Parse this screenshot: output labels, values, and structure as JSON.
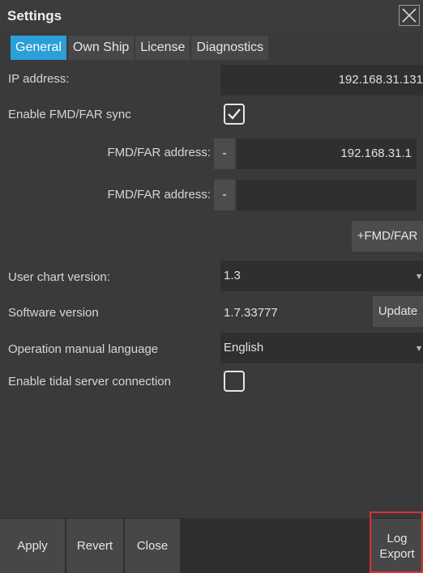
{
  "window": {
    "title": "Settings"
  },
  "tabs": [
    {
      "label": "General",
      "active": true
    },
    {
      "label": "Own Ship",
      "active": false
    },
    {
      "label": "License",
      "active": false
    },
    {
      "label": "Diagnostics",
      "active": false
    }
  ],
  "general": {
    "ip_address": {
      "label": "IP address:",
      "value": "192.168.31.131"
    },
    "fmd_sync": {
      "label": "Enable FMD/FAR sync",
      "checked": true
    },
    "fmd_address_1": {
      "label": "FMD/FAR address:",
      "minus": "-",
      "value": "192.168.31.1"
    },
    "fmd_address_2": {
      "label": "FMD/FAR address:",
      "minus": "-",
      "value": ""
    },
    "add_fmd_button": "+FMD/FAR",
    "user_chart_version": {
      "label": "User chart version:",
      "value": "1.3"
    },
    "software_version": {
      "label": "Software version",
      "value": "1.7.33777",
      "update_button": "Update"
    },
    "manual_language": {
      "label": "Operation manual language",
      "value": "English"
    },
    "tidal_server": {
      "label": "Enable tidal server connection",
      "checked": false
    }
  },
  "footer": {
    "apply": "Apply",
    "revert": "Revert",
    "close": "Close",
    "log_export_line1": "Log",
    "log_export_line2": "Export"
  },
  "colors": {
    "accent": "#2a9fd8",
    "highlight": "#e03030",
    "background": "#3a3a3a"
  }
}
